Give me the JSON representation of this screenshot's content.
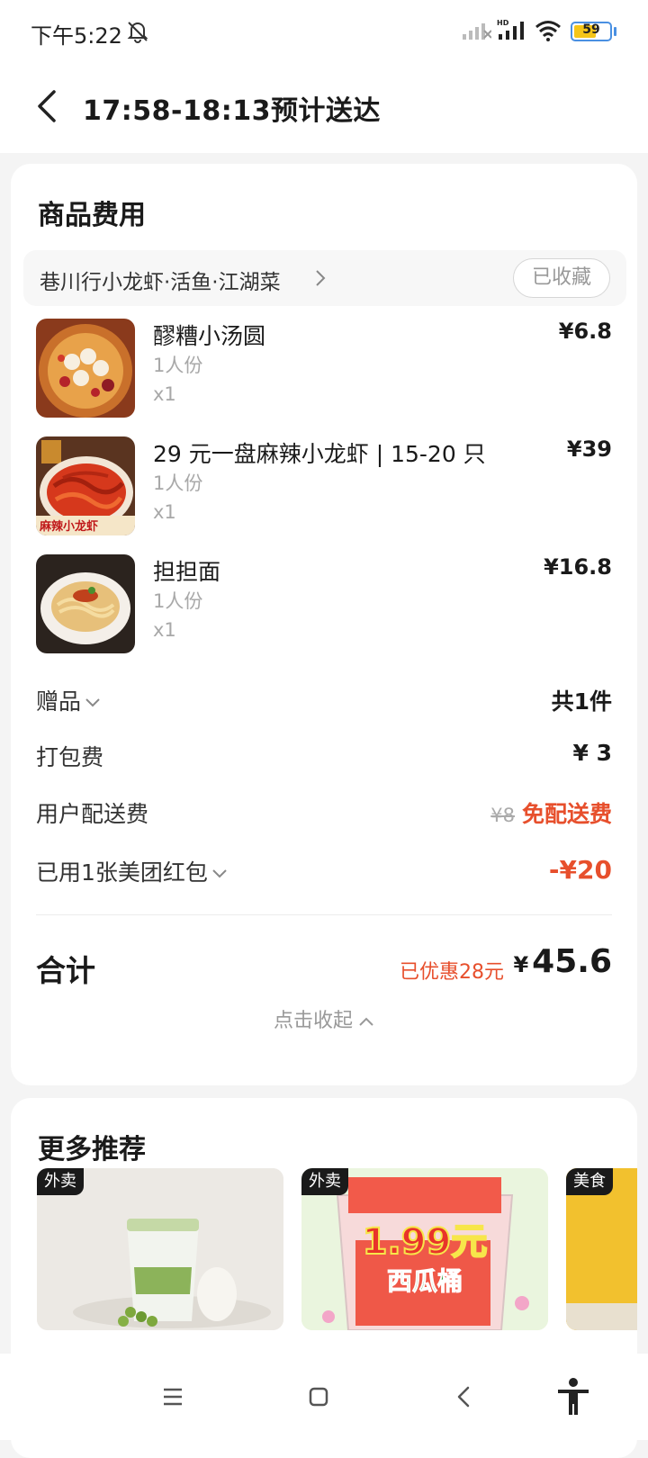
{
  "status_bar": {
    "time": "下午5:22",
    "battery": "59"
  },
  "header": {
    "title": "17:58-18:13预计送达"
  },
  "fees_section": {
    "title": "商品费用",
    "shop_name": "巷川行小龙虾·活鱼·江湖菜",
    "favorite_label": "已收藏",
    "items": [
      {
        "name": "醪糟小汤圆",
        "spec": "1人份",
        "qty": "x1",
        "price": "¥6.8",
        "icon": "dumpling-soup-photo"
      },
      {
        "name": "29 元一盘麻辣小龙虾 | 15-20 只",
        "spec": "1人份",
        "qty": "x1",
        "price": "¥39",
        "icon": "crayfish-photo",
        "image_caption": "麻辣小龙虾"
      },
      {
        "name": "担担面",
        "spec": "1人份",
        "qty": "x1",
        "price": "¥16.8",
        "icon": "noodle-photo"
      }
    ],
    "gift": {
      "label": "赠品",
      "value": "共1件"
    },
    "packing": {
      "label": "打包费",
      "value": "¥ 3"
    },
    "delivery": {
      "label": "用户配送费",
      "original": "¥8",
      "value": "免配送费"
    },
    "coupon": {
      "label": "已用1张美团红包",
      "value": "-¥20"
    },
    "total": {
      "label": "合计",
      "saved": "已优惠28元",
      "currency": "¥",
      "amount": "45.6"
    },
    "collapse_label": "点击收起"
  },
  "recommend_section": {
    "title": "更多推荐",
    "cards": [
      {
        "tag": "外卖",
        "icon": "matcha-drink-photo"
      },
      {
        "tag": "外卖",
        "icon": "watermelon-bucket-photo",
        "poster_price": "1.99元",
        "poster_text": "西瓜桶"
      },
      {
        "tag": "美食",
        "icon": "food-photo"
      }
    ]
  },
  "colors": {
    "accent_red": "#e74f2c",
    "background": "#f4f4f4",
    "card": "#ffffff"
  }
}
